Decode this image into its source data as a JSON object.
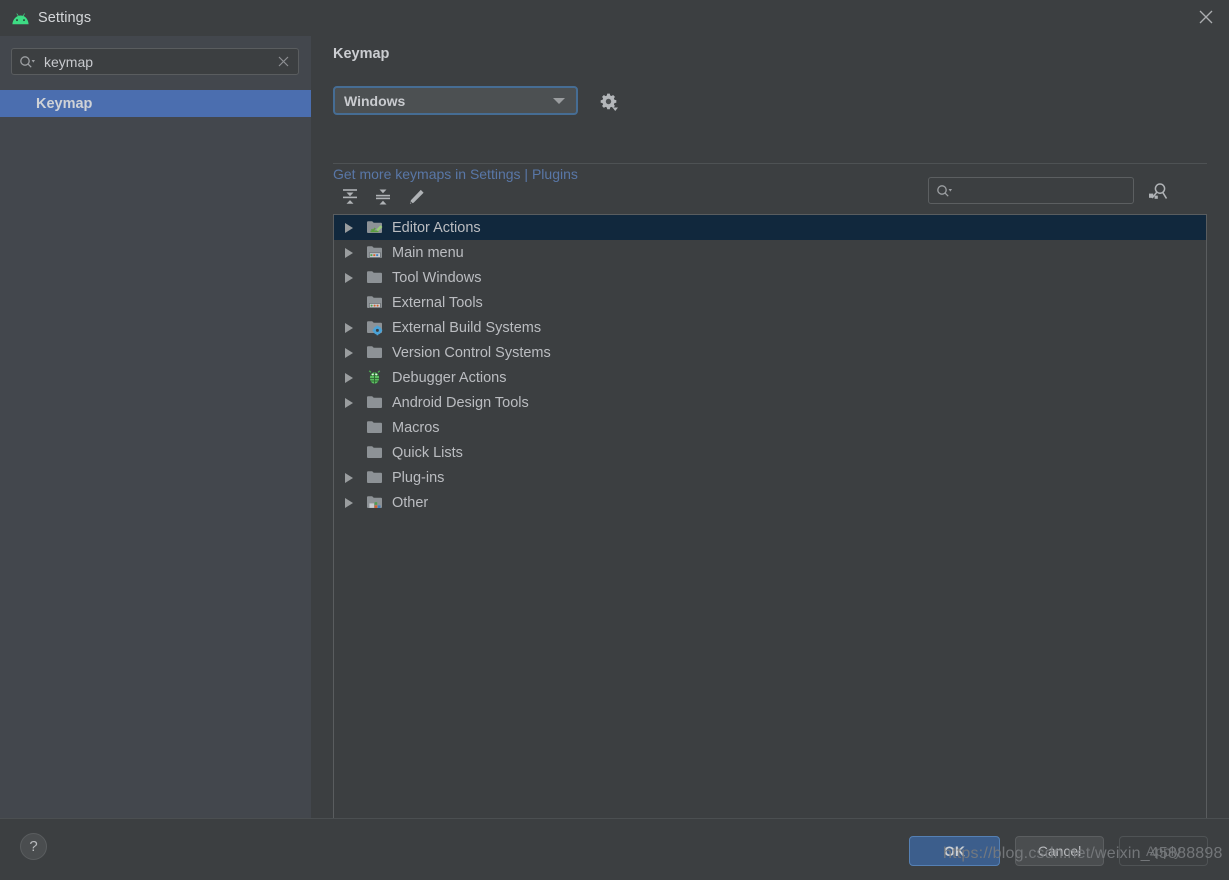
{
  "window": {
    "title": "Settings",
    "icon": "android-icon",
    "close_icon": "close-icon"
  },
  "sidebar": {
    "search": {
      "value": "keymap",
      "placeholder": "",
      "icon": "search-icon",
      "clear_icon": "clear-icon"
    },
    "items": [
      {
        "label": "Keymap",
        "selected": true
      }
    ]
  },
  "main": {
    "section_title": "Keymap",
    "keymap_select": {
      "value": "Windows",
      "arrow_icon": "chevron-down-icon"
    },
    "gear_button": {
      "icon": "gear-dropdown-icon"
    },
    "plugins_link": {
      "prefix": "Get more keymaps in Settings",
      "separator": " | ",
      "suffix": "Plugins"
    },
    "toolbar": {
      "expand_all": {
        "icon": "expand-all-icon",
        "label": "Expand All"
      },
      "collapse_all": {
        "icon": "collapse-all-icon",
        "label": "Collapse All"
      },
      "edit": {
        "icon": "pencil-edit-icon",
        "label": "Edit Shortcut"
      },
      "search": {
        "value": "",
        "placeholder": "",
        "icon": "search-icon"
      },
      "find_by_shortcut": {
        "icon": "find-by-shortcut-icon"
      }
    },
    "tree": [
      {
        "label": "Editor Actions",
        "icon": "folder-editor-icon",
        "expandable": true,
        "selected": true
      },
      {
        "label": "Main menu",
        "icon": "folder-menu-icon",
        "expandable": true,
        "selected": false
      },
      {
        "label": "Tool Windows",
        "icon": "folder-icon",
        "expandable": true,
        "selected": false
      },
      {
        "label": "External Tools",
        "icon": "folder-tools-icon",
        "expandable": false,
        "selected": false
      },
      {
        "label": "External Build Systems",
        "icon": "folder-build-icon",
        "expandable": true,
        "selected": false
      },
      {
        "label": "Version Control Systems",
        "icon": "folder-icon",
        "expandable": true,
        "selected": false
      },
      {
        "label": "Debugger Actions",
        "icon": "bug-icon",
        "expandable": true,
        "selected": false
      },
      {
        "label": "Android Design Tools",
        "icon": "folder-icon",
        "expandable": true,
        "selected": false
      },
      {
        "label": "Macros",
        "icon": "folder-icon",
        "expandable": false,
        "selected": false
      },
      {
        "label": "Quick Lists",
        "icon": "folder-icon",
        "expandable": false,
        "selected": false
      },
      {
        "label": "Plug-ins",
        "icon": "folder-icon",
        "expandable": true,
        "selected": false
      },
      {
        "label": "Other",
        "icon": "folder-other-icon",
        "expandable": true,
        "selected": false
      }
    ]
  },
  "footer": {
    "help_label": "?",
    "ok_label": "OK",
    "cancel_label": "Cancel",
    "apply_label": "Apply"
  },
  "watermark": {
    "text": "https://blog.csdn.net/weixin_45888898"
  },
  "colors": {
    "window_bg": "#3c3f41",
    "sidebar_bg": "#43474d",
    "selection_blue": "#4b6eaf",
    "tree_selection": "#11283d",
    "link_blue": "#5977a7",
    "ok_blue": "#3c5e8c",
    "android_green": "#3ddc84"
  }
}
